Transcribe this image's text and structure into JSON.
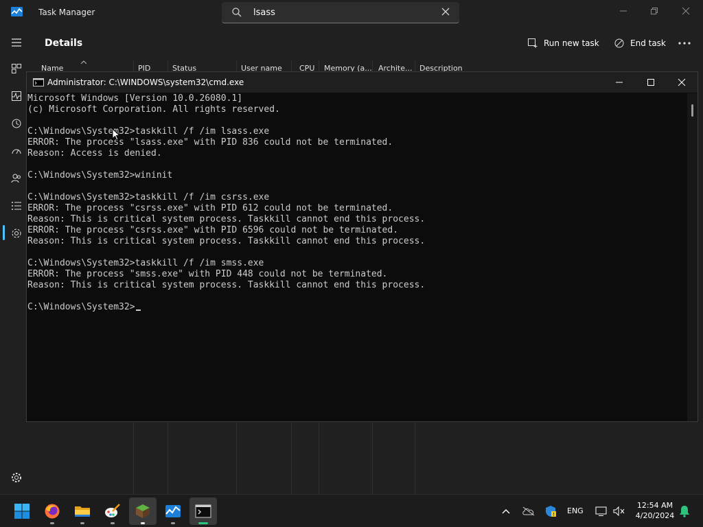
{
  "task_manager": {
    "title": "Task Manager",
    "search_value": "lsass",
    "page_title": "Details",
    "run_new_task_label": "Run new task",
    "end_task_label": "End task",
    "columns": [
      "Name",
      "PID",
      "Status",
      "User name",
      "CPU",
      "Memory (a...",
      "Archite...",
      "Description"
    ]
  },
  "cmd": {
    "title": "Administrator: C:\\WINDOWS\\system32\\cmd.exe",
    "lines": [
      "Microsoft Windows [Version 10.0.26080.1]",
      "(c) Microsoft Corporation. All rights reserved.",
      "",
      "C:\\Windows\\System32>taskkill /f /im lsass.exe",
      "ERROR: The process \"lsass.exe\" with PID 836 could not be terminated.",
      "Reason: Access is denied.",
      "",
      "C:\\Windows\\System32>wininit",
      "",
      "C:\\Windows\\System32>taskkill /f /im csrss.exe",
      "ERROR: The process \"csrss.exe\" with PID 612 could not be terminated.",
      "Reason: This is critical system process. Taskkill cannot end this process.",
      "ERROR: The process \"csrss.exe\" with PID 6596 could not be terminated.",
      "Reason: This is critical system process. Taskkill cannot end this process.",
      "",
      "C:\\Windows\\System32>taskkill /f /im smss.exe",
      "ERROR: The process \"smss.exe\" with PID 448 could not be terminated.",
      "Reason: This is critical system process. Taskkill cannot end this process.",
      "",
      "C:\\Windows\\System32>"
    ]
  },
  "taskbar": {
    "language": "ENG",
    "time": "12:54 AM",
    "date": "4/20/2024",
    "apps": [
      "start-icon",
      "firefox-icon",
      "file-explorer-icon",
      "paint-icon",
      "minecraft-icon",
      "task-manager-icon",
      "terminal-icon"
    ]
  },
  "colors": {
    "accent": "#4cc2ff",
    "console_bg": "#0c0c0c",
    "console_text": "#cccccc",
    "notification": "#2ec27e"
  }
}
